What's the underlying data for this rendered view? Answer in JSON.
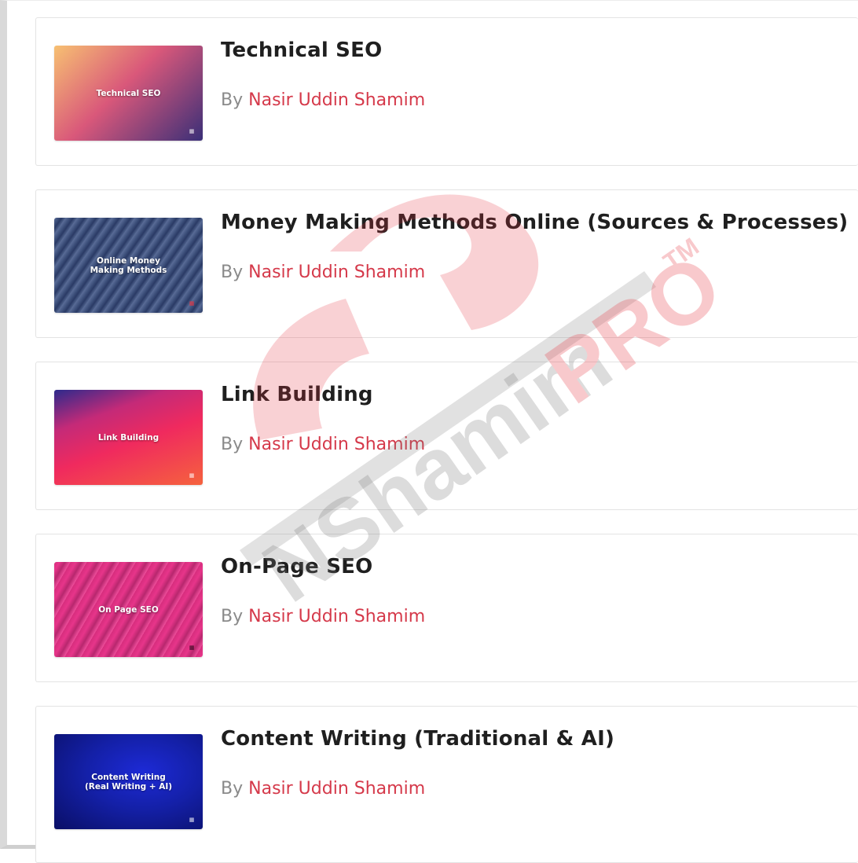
{
  "courses": [
    {
      "title": "Technical SEO",
      "by": "By",
      "author": "Nasir Uddin Shamim",
      "thumb_label": "Technical SEO",
      "thumb_gradient": [
        "#f5b26b",
        "#c9456f",
        "#3b2f7a"
      ]
    },
    {
      "title": "Money Making Methods Online (Sources & Processes)",
      "by": "By",
      "author": "Nasir Uddin Shamim",
      "thumb_label": "Online Money\nMaking Methods",
      "thumb_gradient": [
        "#6e7fa8",
        "#3d4f7e",
        "#1f2c52"
      ]
    },
    {
      "title": "Link Building",
      "by": "By",
      "author": "Nasir Uddin Shamim",
      "thumb_label": "Link Building",
      "thumb_gradient": [
        "#3b2c8a",
        "#ef2d6a",
        "#f5793c"
      ]
    },
    {
      "title": "On-Page SEO",
      "by": "By",
      "author": "Nasir Uddin Shamim",
      "thumb_label": "On Page SEO",
      "thumb_gradient": [
        "#a52b7a",
        "#e0307a",
        "#f04fa0"
      ]
    },
    {
      "title": "Content Writing (Traditional & AI)",
      "by": "By",
      "author": "Nasir Uddin Shamim",
      "thumb_label": "Content Writing\n(Real Writing + AI)",
      "thumb_gradient": [
        "#0a0f6e",
        "#1a25c9",
        "#0b1182"
      ]
    }
  ],
  "watermark": {
    "brand": "NShamimPRO",
    "brand_primary": "NShamim",
    "brand_accent": "PRO",
    "trademark": "TM",
    "colors": {
      "accent": "#e8333f",
      "gray": "#7a7a7a"
    }
  }
}
